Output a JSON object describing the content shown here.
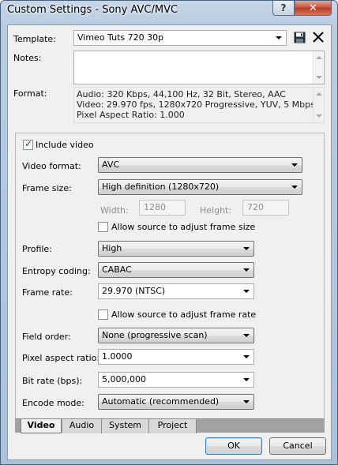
{
  "window": {
    "title": "Custom Settings - Sony AVC/MVC",
    "help_glyph": "?",
    "close_glyph": "✕"
  },
  "template": {
    "label": "Template:",
    "value": "Vimeo Tuts 720 30p"
  },
  "notes": {
    "label": "Notes:",
    "value": ""
  },
  "format": {
    "label": "Format:",
    "lines": [
      "Audio: 320 Kbps, 44,100 Hz, 32 Bit, Stereo, AAC",
      "Video: 29.970 fps, 1280x720 Progressive, YUV, 5 Mbps",
      "Pixel Aspect Ratio: 1.000"
    ]
  },
  "video": {
    "include_video_label": "Include video",
    "include_video_checked": true,
    "video_format": {
      "label": "Video format:",
      "value": "AVC"
    },
    "frame_size": {
      "label": "Frame size:",
      "value": "High definition (1280x720)"
    },
    "width": {
      "label": "Width:",
      "value": "1280"
    },
    "height": {
      "label": "Height:",
      "value": "720"
    },
    "allow_frame_size_label": "Allow source to adjust frame size",
    "profile": {
      "label": "Profile:",
      "value": "High"
    },
    "entropy": {
      "label": "Entropy coding:",
      "value": "CABAC"
    },
    "frame_rate": {
      "label": "Frame rate:",
      "value": "29.970 (NTSC)"
    },
    "allow_frame_rate_label": "Allow source to adjust frame rate",
    "field_order": {
      "label": "Field order:",
      "value": "None (progressive scan)"
    },
    "pixel_aspect": {
      "label": "Pixel aspect ratio:",
      "value": "1.0000"
    },
    "bit_rate": {
      "label": "Bit rate (bps):",
      "value": "5,000,000"
    },
    "encode_mode": {
      "label": "Encode mode:",
      "value": "Automatic (recommended)"
    }
  },
  "tabs": [
    "Video",
    "Audio",
    "System",
    "Project"
  ],
  "buttons": {
    "ok": "OK",
    "cancel": "Cancel"
  },
  "icons": {
    "save": "floppy-disk-icon",
    "delete": "close-icon"
  }
}
